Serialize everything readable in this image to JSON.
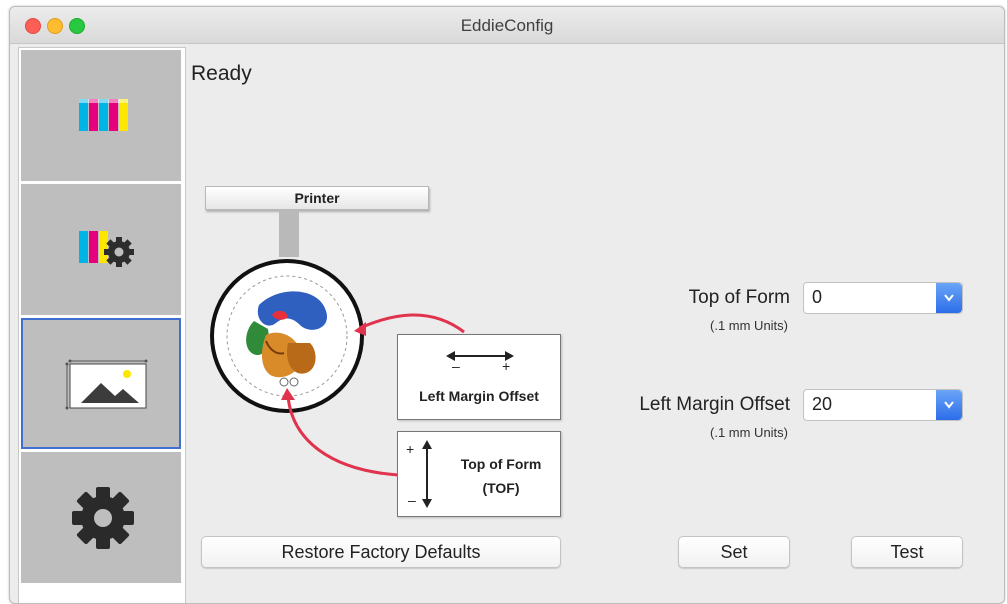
{
  "window": {
    "title": "EddieConfig"
  },
  "sidebar": {
    "items": [
      {
        "name": "ink-colors",
        "icon": "ink-cartridges-icon"
      },
      {
        "name": "ink-settings",
        "icon": "ink-gear-icon"
      },
      {
        "name": "image-alignment",
        "icon": "image-alignment-icon",
        "selected": true
      },
      {
        "name": "settings",
        "icon": "gear-icon"
      }
    ]
  },
  "status": "Ready",
  "diagram": {
    "printer_label": "Printer",
    "left_margin_label": "Left Margin Offset",
    "tof_label_line1": "Top of Form",
    "tof_label_line2": "(TOF)",
    "arrow_minus": "–",
    "arrow_plus": "+"
  },
  "form": {
    "top_of_form": {
      "label": "Top of Form",
      "units": "(.1 mm Units)",
      "value": "0"
    },
    "left_margin_offset": {
      "label": "Left Margin Offset",
      "units": "(.1 mm Units)",
      "value": "20"
    }
  },
  "buttons": {
    "restore": "Restore Factory Defaults",
    "set": "Set",
    "test": "Test"
  },
  "colors": {
    "accent": "#3f6fd0",
    "arrow_red": "#e0334d",
    "combo_blue": "#2c6de9"
  }
}
